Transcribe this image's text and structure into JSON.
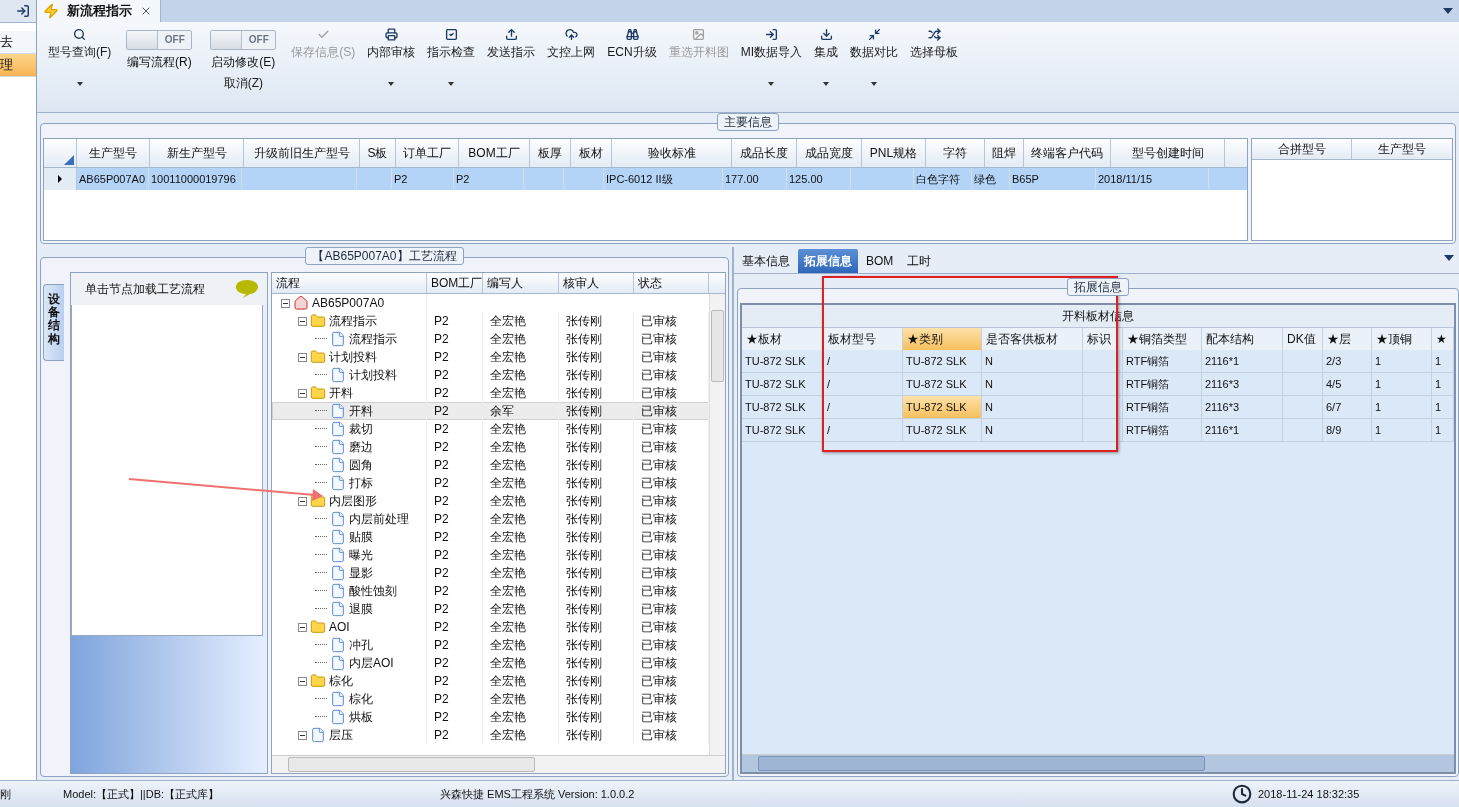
{
  "sidebar": {
    "items": [
      {
        "label": "去",
        "selected": false
      },
      {
        "label": "理",
        "selected": true
      }
    ]
  },
  "tabs": [
    {
      "label": "新流程指示",
      "selected": true,
      "closable": true
    }
  ],
  "toolbar": [
    {
      "kind": "button",
      "label": "型号查询(F)",
      "disabled": false,
      "dropdown": true
    },
    {
      "kind": "toggle",
      "label": "编写流程(R)",
      "on": false,
      "toggle_text": "OFF"
    },
    {
      "kind": "toggle",
      "label": "启动修改(E)",
      "second_label": "取消(Z)",
      "on": false,
      "toggle_text": "OFF"
    },
    {
      "kind": "button",
      "label": "保存信息(S)",
      "disabled": true,
      "dropdown": false
    },
    {
      "kind": "button",
      "label": "内部审核",
      "disabled": false,
      "dropdown": true
    },
    {
      "kind": "button",
      "label": "指示检查",
      "disabled": false,
      "dropdown": true
    },
    {
      "kind": "button",
      "label": "发送指示",
      "disabled": false,
      "dropdown": false
    },
    {
      "kind": "button",
      "label": "文控上网",
      "disabled": false,
      "dropdown": false
    },
    {
      "kind": "button",
      "label": "ECN升级",
      "disabled": false,
      "dropdown": false
    },
    {
      "kind": "button",
      "label": "重选开料图",
      "disabled": true,
      "dropdown": false
    },
    {
      "kind": "button",
      "label": "MI数据导入",
      "disabled": false,
      "dropdown": true
    },
    {
      "kind": "button",
      "label": "集成",
      "disabled": false,
      "dropdown": true
    },
    {
      "kind": "button",
      "label": "数据对比",
      "disabled": false,
      "dropdown": true
    },
    {
      "kind": "button",
      "label": "选择母板",
      "disabled": false,
      "dropdown": false
    }
  ],
  "main_info": {
    "title": "主要信息",
    "columns": [
      "生产型号",
      "新生产型号",
      "升级前旧生产型号",
      "S板",
      "订单工厂",
      "BOM工厂",
      "板厚",
      "板材",
      "验收标准",
      "成品长度",
      "成品宽度",
      "PNL规格",
      "字符",
      "阻焊",
      "终端客户代码",
      "型号创建时间"
    ],
    "rows": [
      {
        "selected": true,
        "cells": [
          "AB65P007A0",
          "10011000019796",
          "",
          "",
          "P2",
          "P2",
          "",
          "",
          "IPC-6012 II级",
          "177.00",
          "125.00",
          "",
          "白色字符",
          "绿色",
          "B65P",
          "2018/11/15"
        ]
      }
    ],
    "merge_columns": [
      "合拼型号",
      "生产型号"
    ]
  },
  "process": {
    "title": "【AB65P007A0】工艺流程",
    "side_tab": "设备结构",
    "hint": "单击节点加载工艺流程",
    "columns": [
      "流程",
      "BOM工厂",
      "编写人",
      "核审人",
      "状态"
    ],
    "tree": {
      "label": "AB65P007A0",
      "expanded": true,
      "selected": false,
      "children": [
        {
          "label": "流程指示",
          "bom": "P2",
          "writer": "全宏艳",
          "reviewer": "张传刚",
          "status": "已审核",
          "expanded": true,
          "selected": false,
          "children": [
            {
              "label": "流程指示",
              "bom": "P2",
              "writer": "全宏艳",
              "reviewer": "张传刚",
              "status": "已审核",
              "selected": false
            }
          ]
        },
        {
          "label": "计划投料",
          "bom": "P2",
          "writer": "全宏艳",
          "reviewer": "张传刚",
          "status": "已审核",
          "expanded": true,
          "selected": false,
          "children": [
            {
              "label": "计划投料",
              "bom": "P2",
              "writer": "全宏艳",
              "reviewer": "张传刚",
              "status": "已审核",
              "selected": false
            }
          ]
        },
        {
          "label": "开料",
          "bom": "P2",
          "writer": "全宏艳",
          "reviewer": "张传刚",
          "status": "已审核",
          "expanded": true,
          "selected": false,
          "children": [
            {
              "label": "开料",
              "bom": "P2",
              "writer": "余军",
              "reviewer": "张传刚",
              "status": "已审核",
              "selected": true
            },
            {
              "label": "裁切",
              "bom": "P2",
              "writer": "全宏艳",
              "reviewer": "张传刚",
              "status": "已审核",
              "selected": false
            },
            {
              "label": "磨边",
              "bom": "P2",
              "writer": "全宏艳",
              "reviewer": "张传刚",
              "status": "已审核",
              "selected": false
            },
            {
              "label": "圆角",
              "bom": "P2",
              "writer": "全宏艳",
              "reviewer": "张传刚",
              "status": "已审核",
              "selected": false
            },
            {
              "label": "打标",
              "bom": "P2",
              "writer": "全宏艳",
              "reviewer": "张传刚",
              "status": "已审核",
              "selected": false
            }
          ]
        },
        {
          "label": "内层图形",
          "bom": "P2",
          "writer": "全宏艳",
          "reviewer": "张传刚",
          "status": "已审核",
          "expanded": true,
          "selected": false,
          "children": [
            {
              "label": "内层前处理",
              "bom": "P2",
              "writer": "全宏艳",
              "reviewer": "张传刚",
              "status": "已审核",
              "selected": false
            },
            {
              "label": "贴膜",
              "bom": "P2",
              "writer": "全宏艳",
              "reviewer": "张传刚",
              "status": "已审核",
              "selected": false
            },
            {
              "label": "曝光",
              "bom": "P2",
              "writer": "全宏艳",
              "reviewer": "张传刚",
              "status": "已审核",
              "selected": false
            },
            {
              "label": "显影",
              "bom": "P2",
              "writer": "全宏艳",
              "reviewer": "张传刚",
              "status": "已审核",
              "selected": false
            },
            {
              "label": "酸性蚀刻",
              "bom": "P2",
              "writer": "全宏艳",
              "reviewer": "张传刚",
              "status": "已审核",
              "selected": false
            },
            {
              "label": "退膜",
              "bom": "P2",
              "writer": "全宏艳",
              "reviewer": "张传刚",
              "status": "已审核",
              "selected": false
            }
          ]
        },
        {
          "label": "AOI",
          "bom": "P2",
          "writer": "全宏艳",
          "reviewer": "张传刚",
          "status": "已审核",
          "expanded": true,
          "selected": false,
          "children": [
            {
              "label": "冲孔",
              "bom": "P2",
              "writer": "全宏艳",
              "reviewer": "张传刚",
              "status": "已审核",
              "selected": false
            },
            {
              "label": "内层AOI",
              "bom": "P2",
              "writer": "全宏艳",
              "reviewer": "张传刚",
              "status": "已审核",
              "selected": false
            }
          ]
        },
        {
          "label": "棕化",
          "bom": "P2",
          "writer": "全宏艳",
          "reviewer": "张传刚",
          "status": "已审核",
          "expanded": true,
          "selected": false,
          "children": [
            {
              "label": "棕化",
              "bom": "P2",
              "writer": "全宏艳",
              "reviewer": "张传刚",
              "status": "已审核",
              "selected": false
            },
            {
              "label": "烘板",
              "bom": "P2",
              "writer": "全宏艳",
              "reviewer": "张传刚",
              "status": "已审核",
              "selected": false
            }
          ]
        },
        {
          "label": "层压",
          "bom": "P2",
          "writer": "全宏艳",
          "reviewer": "张传刚",
          "status": "已审核",
          "expanded": true,
          "selected": false
        }
      ]
    }
  },
  "detail": {
    "tabs": [
      {
        "label": "基本信息",
        "selected": false
      },
      {
        "label": "拓展信息",
        "selected": true
      },
      {
        "label": "BOM",
        "selected": false
      },
      {
        "label": "工时",
        "selected": false
      }
    ],
    "legend": "拓展信息",
    "grid_title": "开料板材信息",
    "columns": [
      {
        "label": "★板材",
        "selected": false
      },
      {
        "label": "板材型号",
        "selected": false
      },
      {
        "label": "★类别",
        "selected": true
      },
      {
        "label": "是否客供板材",
        "selected": false
      },
      {
        "label": "标识",
        "selected": false
      },
      {
        "label": "★铜箔类型",
        "selected": false
      },
      {
        "label": "配本结构",
        "selected": false
      },
      {
        "label": "DK值",
        "selected": false
      },
      {
        "label": "★层",
        "selected": false
      },
      {
        "label": "★顶铜",
        "selected": false
      },
      {
        "label": "★",
        "selected": false
      }
    ],
    "rows": [
      {
        "selected": false,
        "cells": [
          "TU-872 SLK",
          "/",
          "TU-872 SLK",
          "N",
          "",
          "RTF铜箔",
          "2116*1",
          "",
          "2/3",
          "1",
          "1"
        ]
      },
      {
        "selected": false,
        "cells": [
          "TU-872 SLK",
          "/",
          "TU-872 SLK",
          "N",
          "",
          "RTF铜箔",
          "2116*3",
          "",
          "4/5",
          "1",
          "1"
        ]
      },
      {
        "selected": true,
        "cells": [
          "TU-872 SLK",
          "/",
          "TU-872 SLK",
          "N",
          "",
          "RTF铜箔",
          "2116*3",
          "",
          "6/7",
          "1",
          "1"
        ]
      },
      {
        "selected": false,
        "cells": [
          "TU-872 SLK",
          "/",
          "TU-872 SLK",
          "N",
          "",
          "RTF铜箔",
          "2116*1",
          "",
          "8/9",
          "1",
          "1"
        ]
      }
    ]
  },
  "status_bar": {
    "user": "刚",
    "model": "Model:【正式】||DB:【正式库】",
    "system": "兴森快捷 EMS工程系统 Version: 1.0.0.2",
    "time": "2018-11-24 18:32:35"
  }
}
